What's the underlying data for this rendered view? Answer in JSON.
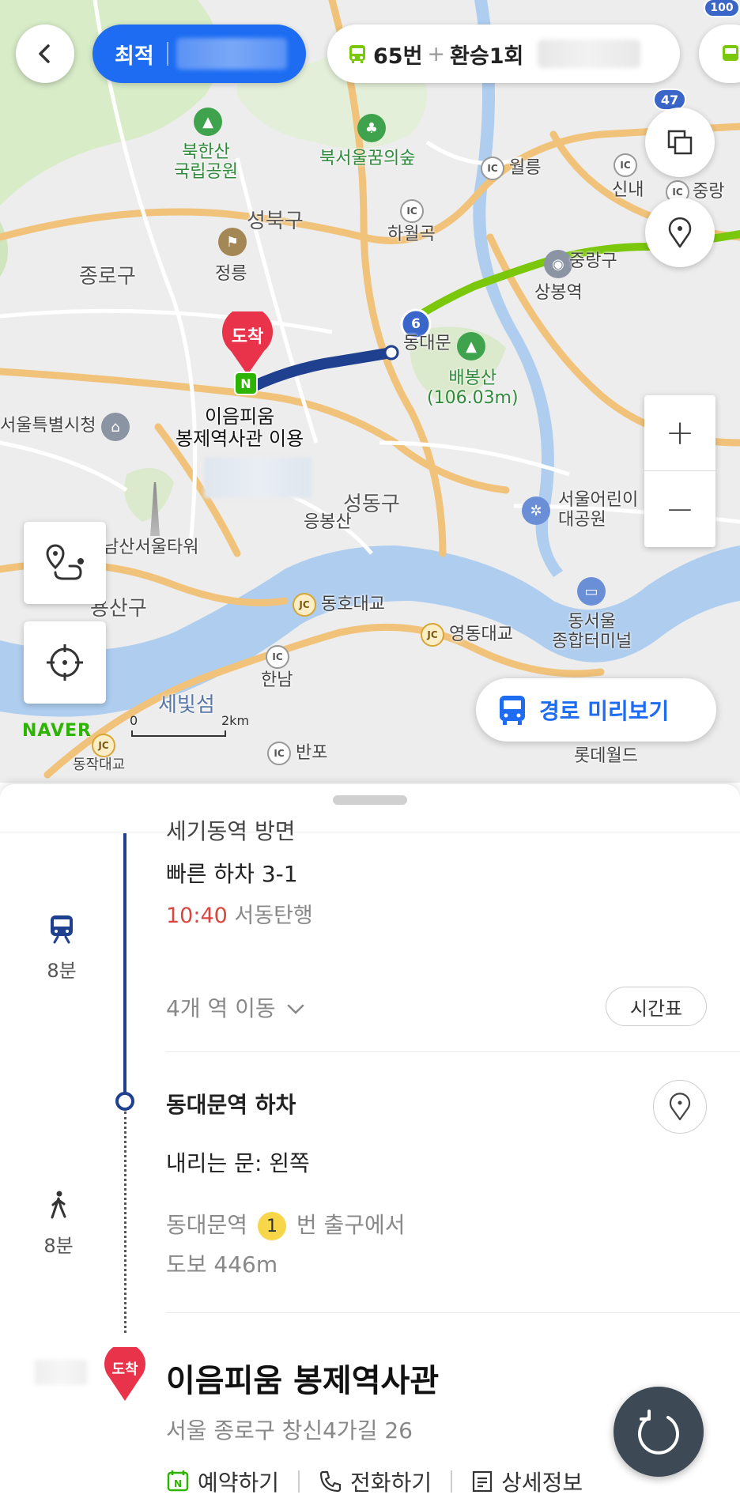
{
  "top_bar": {
    "route_tab_label": "최적",
    "route_summary_bus": "65번",
    "route_summary_plus": "+",
    "route_summary_transfer": "환승1회"
  },
  "map": {
    "labels": {
      "bukhansan": "북한산\n국립공원",
      "bukseoul": "북서울꿈의숲",
      "seongbuk": "성북구",
      "jongno": "종로구",
      "jeongneung": "정릉",
      "dest_poi": "이음피움\n봉제역사관 이용",
      "dest_marker": "도착",
      "baebongsan": "배봉산\n(106.03m)",
      "dongdaemun": "동대문",
      "sangbong": "상봉역",
      "jungnang": "중랑구",
      "seoul_city_hall": "서울특별시청",
      "seongdong": "성동구",
      "eungbongsan": "응봉산",
      "namsan": "남산서울타워",
      "yongsan": "용산구",
      "children_park": "서울어린이\n대공원",
      "dong_seoul": "동서울\n종합터미널",
      "dongho": "동호대교",
      "yeongdong": "영동대교",
      "hannam": "한남",
      "banpo": "반포",
      "sebitseom": "세빛섬",
      "dongjak": "동작대교",
      "lotte": "롯데월드",
      "wolgye": "월릉",
      "sinnae": "신내",
      "jungnang_ic": "중랑",
      "hawolgok": "하월곡",
      "route_badge": "6",
      "road_47": "47",
      "road_100": "100",
      "ic": "IC",
      "jc": "JC"
    },
    "zoom_in": "+",
    "zoom_out": "−",
    "preview_label": "경로 미리보기",
    "brand": "NAVER",
    "scale_0": "0",
    "scale_2": "2km"
  },
  "sheet": {
    "partial_stop_line": "세기동역 방면",
    "fast_exit": "빠른 하차 3-1",
    "arrival_time": "10:40",
    "direction": "서동탄행",
    "subway_duration": "8분",
    "stations_move": "4개 역 이동",
    "timetable_label": "시간표",
    "alight_station": "동대문역 하차",
    "door_side": "내리는 문: 왼쪽",
    "walk_duration": "8분",
    "walk_from_station": "동대문역",
    "exit_number": "1",
    "walk_exit_suffix": "번 출구에서",
    "walk_distance": "도보 446m",
    "dest_badge": "도착",
    "dest_name": "이음피움 봉제역사관",
    "dest_address": "서울 종로구 창신4가길 26",
    "actions": {
      "reserve": "예약하기",
      "call": "전화하기",
      "detail": "상세정보"
    }
  },
  "colors": {
    "accent_blue": "#1d6cf2",
    "route_navy": "#1f3f8f",
    "route_green": "#7ac70c",
    "dest_red": "#e8334a",
    "time_red": "#d9463f",
    "naver_green": "#2db400"
  }
}
